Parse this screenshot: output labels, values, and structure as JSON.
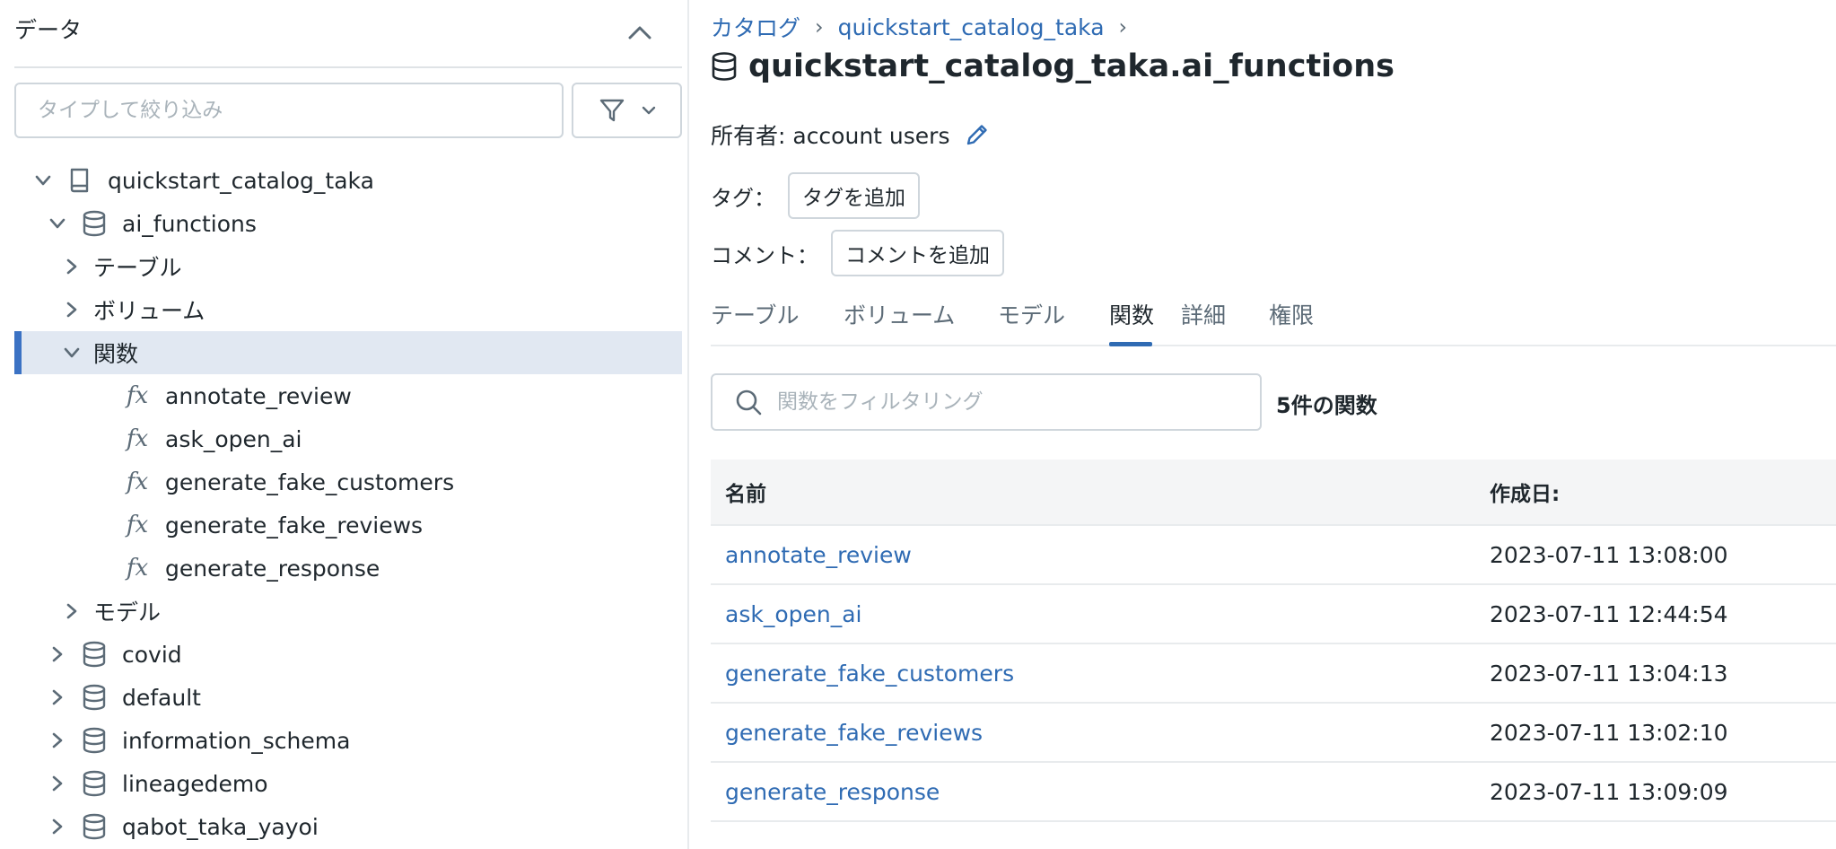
{
  "sidebar": {
    "header": "データ",
    "filter_placeholder": "タイプして絞り込み",
    "tree": [
      {
        "label": "quickstart_catalog_taka",
        "kind": "catalog",
        "level": 0,
        "expanded": true
      },
      {
        "label": "ai_functions",
        "kind": "schema",
        "level": 1,
        "expanded": true
      },
      {
        "label": "テーブル",
        "kind": "folder",
        "level": 2,
        "expanded": false
      },
      {
        "label": "ボリューム",
        "kind": "folder",
        "level": 2,
        "expanded": false
      },
      {
        "label": "関数",
        "kind": "folder",
        "level": 2,
        "expanded": true,
        "selected": true
      },
      {
        "label": "annotate_review",
        "kind": "function",
        "level": 3
      },
      {
        "label": "ask_open_ai",
        "kind": "function",
        "level": 3
      },
      {
        "label": "generate_fake_customers",
        "kind": "function",
        "level": 3
      },
      {
        "label": "generate_fake_reviews",
        "kind": "function",
        "level": 3
      },
      {
        "label": "generate_response",
        "kind": "function",
        "level": 3
      },
      {
        "label": "モデル",
        "kind": "folder",
        "level": 2,
        "expanded": false
      },
      {
        "label": "covid",
        "kind": "schema",
        "level": 1,
        "expanded": false
      },
      {
        "label": "default",
        "kind": "schema",
        "level": 1,
        "expanded": false
      },
      {
        "label": "information_schema",
        "kind": "schema",
        "level": 1,
        "expanded": false
      },
      {
        "label": "lineagedemo",
        "kind": "schema",
        "level": 1,
        "expanded": false
      },
      {
        "label": "qabot_taka_yayoi",
        "kind": "schema",
        "level": 1,
        "expanded": false
      }
    ]
  },
  "breadcrumb": {
    "items": [
      "カタログ",
      "quickstart_catalog_taka"
    ],
    "separator": "›"
  },
  "main": {
    "title": "quickstart_catalog_taka.ai_functions",
    "owner_text": "所有者: account users",
    "tags_label": "タグ：",
    "add_tag_button": "タグを追加",
    "comment_label": "コメント：",
    "add_comment_button": "コメントを追加",
    "tabs": [
      "テーブル",
      "ボリューム",
      "モデル",
      "関数",
      "詳細",
      "権限"
    ],
    "active_tab": "関数",
    "function_filter_placeholder": "関数をフィルタリング",
    "function_count": "5件の関数",
    "table": {
      "columns": [
        "名前",
        "作成日:"
      ],
      "rows": [
        {
          "name": "annotate_review",
          "created": "2023-07-11 13:08:00"
        },
        {
          "name": "ask_open_ai",
          "created": "2023-07-11 12:44:54"
        },
        {
          "name": "generate_fake_customers",
          "created": "2023-07-11 13:04:13"
        },
        {
          "name": "generate_fake_reviews",
          "created": "2023-07-11 13:02:10"
        },
        {
          "name": "generate_response",
          "created": "2023-07-11 13:09:09"
        }
      ]
    }
  },
  "colors": {
    "accent": "#2f6bb3",
    "selected_bg": "#e1e8f2",
    "selected_bar": "#3b72c4",
    "icon": "#5c6b77"
  }
}
